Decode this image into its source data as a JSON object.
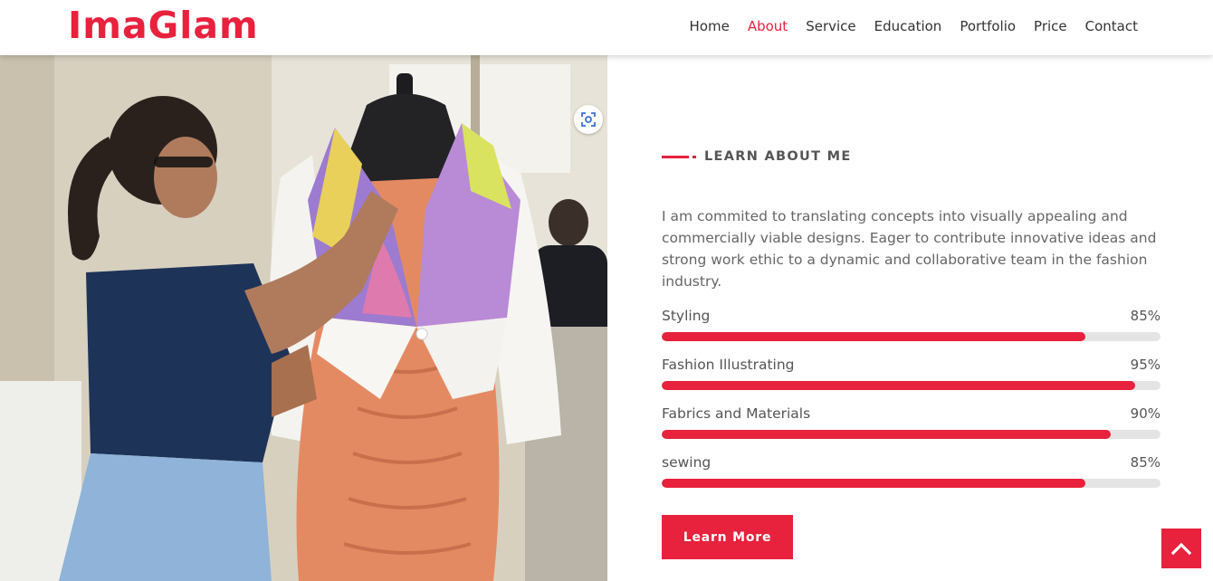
{
  "brand": {
    "logo_text": "ImaGlam",
    "accent_color": "#e8213d"
  },
  "nav": {
    "items": [
      {
        "label": "Home",
        "active": false
      },
      {
        "label": "About",
        "active": true
      },
      {
        "label": "Service",
        "active": false
      },
      {
        "label": "Education",
        "active": false
      },
      {
        "label": "Portfolio",
        "active": false
      },
      {
        "label": "Price",
        "active": false
      },
      {
        "label": "Contact",
        "active": false
      }
    ]
  },
  "hero_image": {
    "icon": "visual-search-lens-icon"
  },
  "about": {
    "eyebrow": "LEARN ABOUT ME",
    "paragraph": "I am commited to translating concepts into visually appealing and commercially viable designs. Eager to contribute innovative ideas and strong work ethic to a dynamic and collaborative team in the fashion industry.",
    "skills": [
      {
        "label": "Styling",
        "percent_text": "85%",
        "value": 85
      },
      {
        "label": "Fashion Illustrating",
        "percent_text": "95%",
        "value": 95
      },
      {
        "label": "Fabrics and Materials",
        "percent_text": "90%",
        "value": 90
      },
      {
        "label": "sewing",
        "percent_text": "85%",
        "value": 85
      }
    ],
    "cta_label": "Learn More"
  },
  "back_to_top": {
    "icon": "chevron-up-icon"
  }
}
